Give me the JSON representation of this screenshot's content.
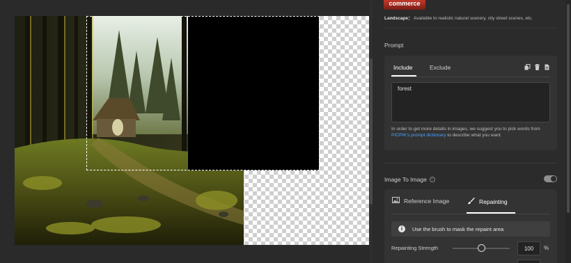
{
  "panel": {
    "logo_text": "commerce",
    "landscape": {
      "label": "Landscape：",
      "description": "Available to realistic natural scenery, city street scenes, etc."
    },
    "prompt": {
      "title": "Prompt",
      "tabs": [
        {
          "label": "Include",
          "active": true
        },
        {
          "label": "Exclude",
          "active": false
        }
      ],
      "tool_icons": [
        "copy-icon",
        "trash-icon",
        "document-icon"
      ],
      "text_value": "forest",
      "hint_before": "In order to get more details in images, we suggest you to pick words from ",
      "hint_link": "PICPIK's prompt dictionary",
      "hint_after": " to describe what you want."
    },
    "image_to_image": {
      "title": "Image To Image",
      "enabled": true,
      "tabs": [
        {
          "label": "Reference Image",
          "icon": "image-icon",
          "active": false
        },
        {
          "label": "Repainting",
          "icon": "brush-icon",
          "active": true
        }
      ],
      "brush_note": "Use the brush to mask the repaint area",
      "strength_label": "Repainting Strength",
      "strength_value": "100",
      "strength_unit": "%"
    }
  }
}
